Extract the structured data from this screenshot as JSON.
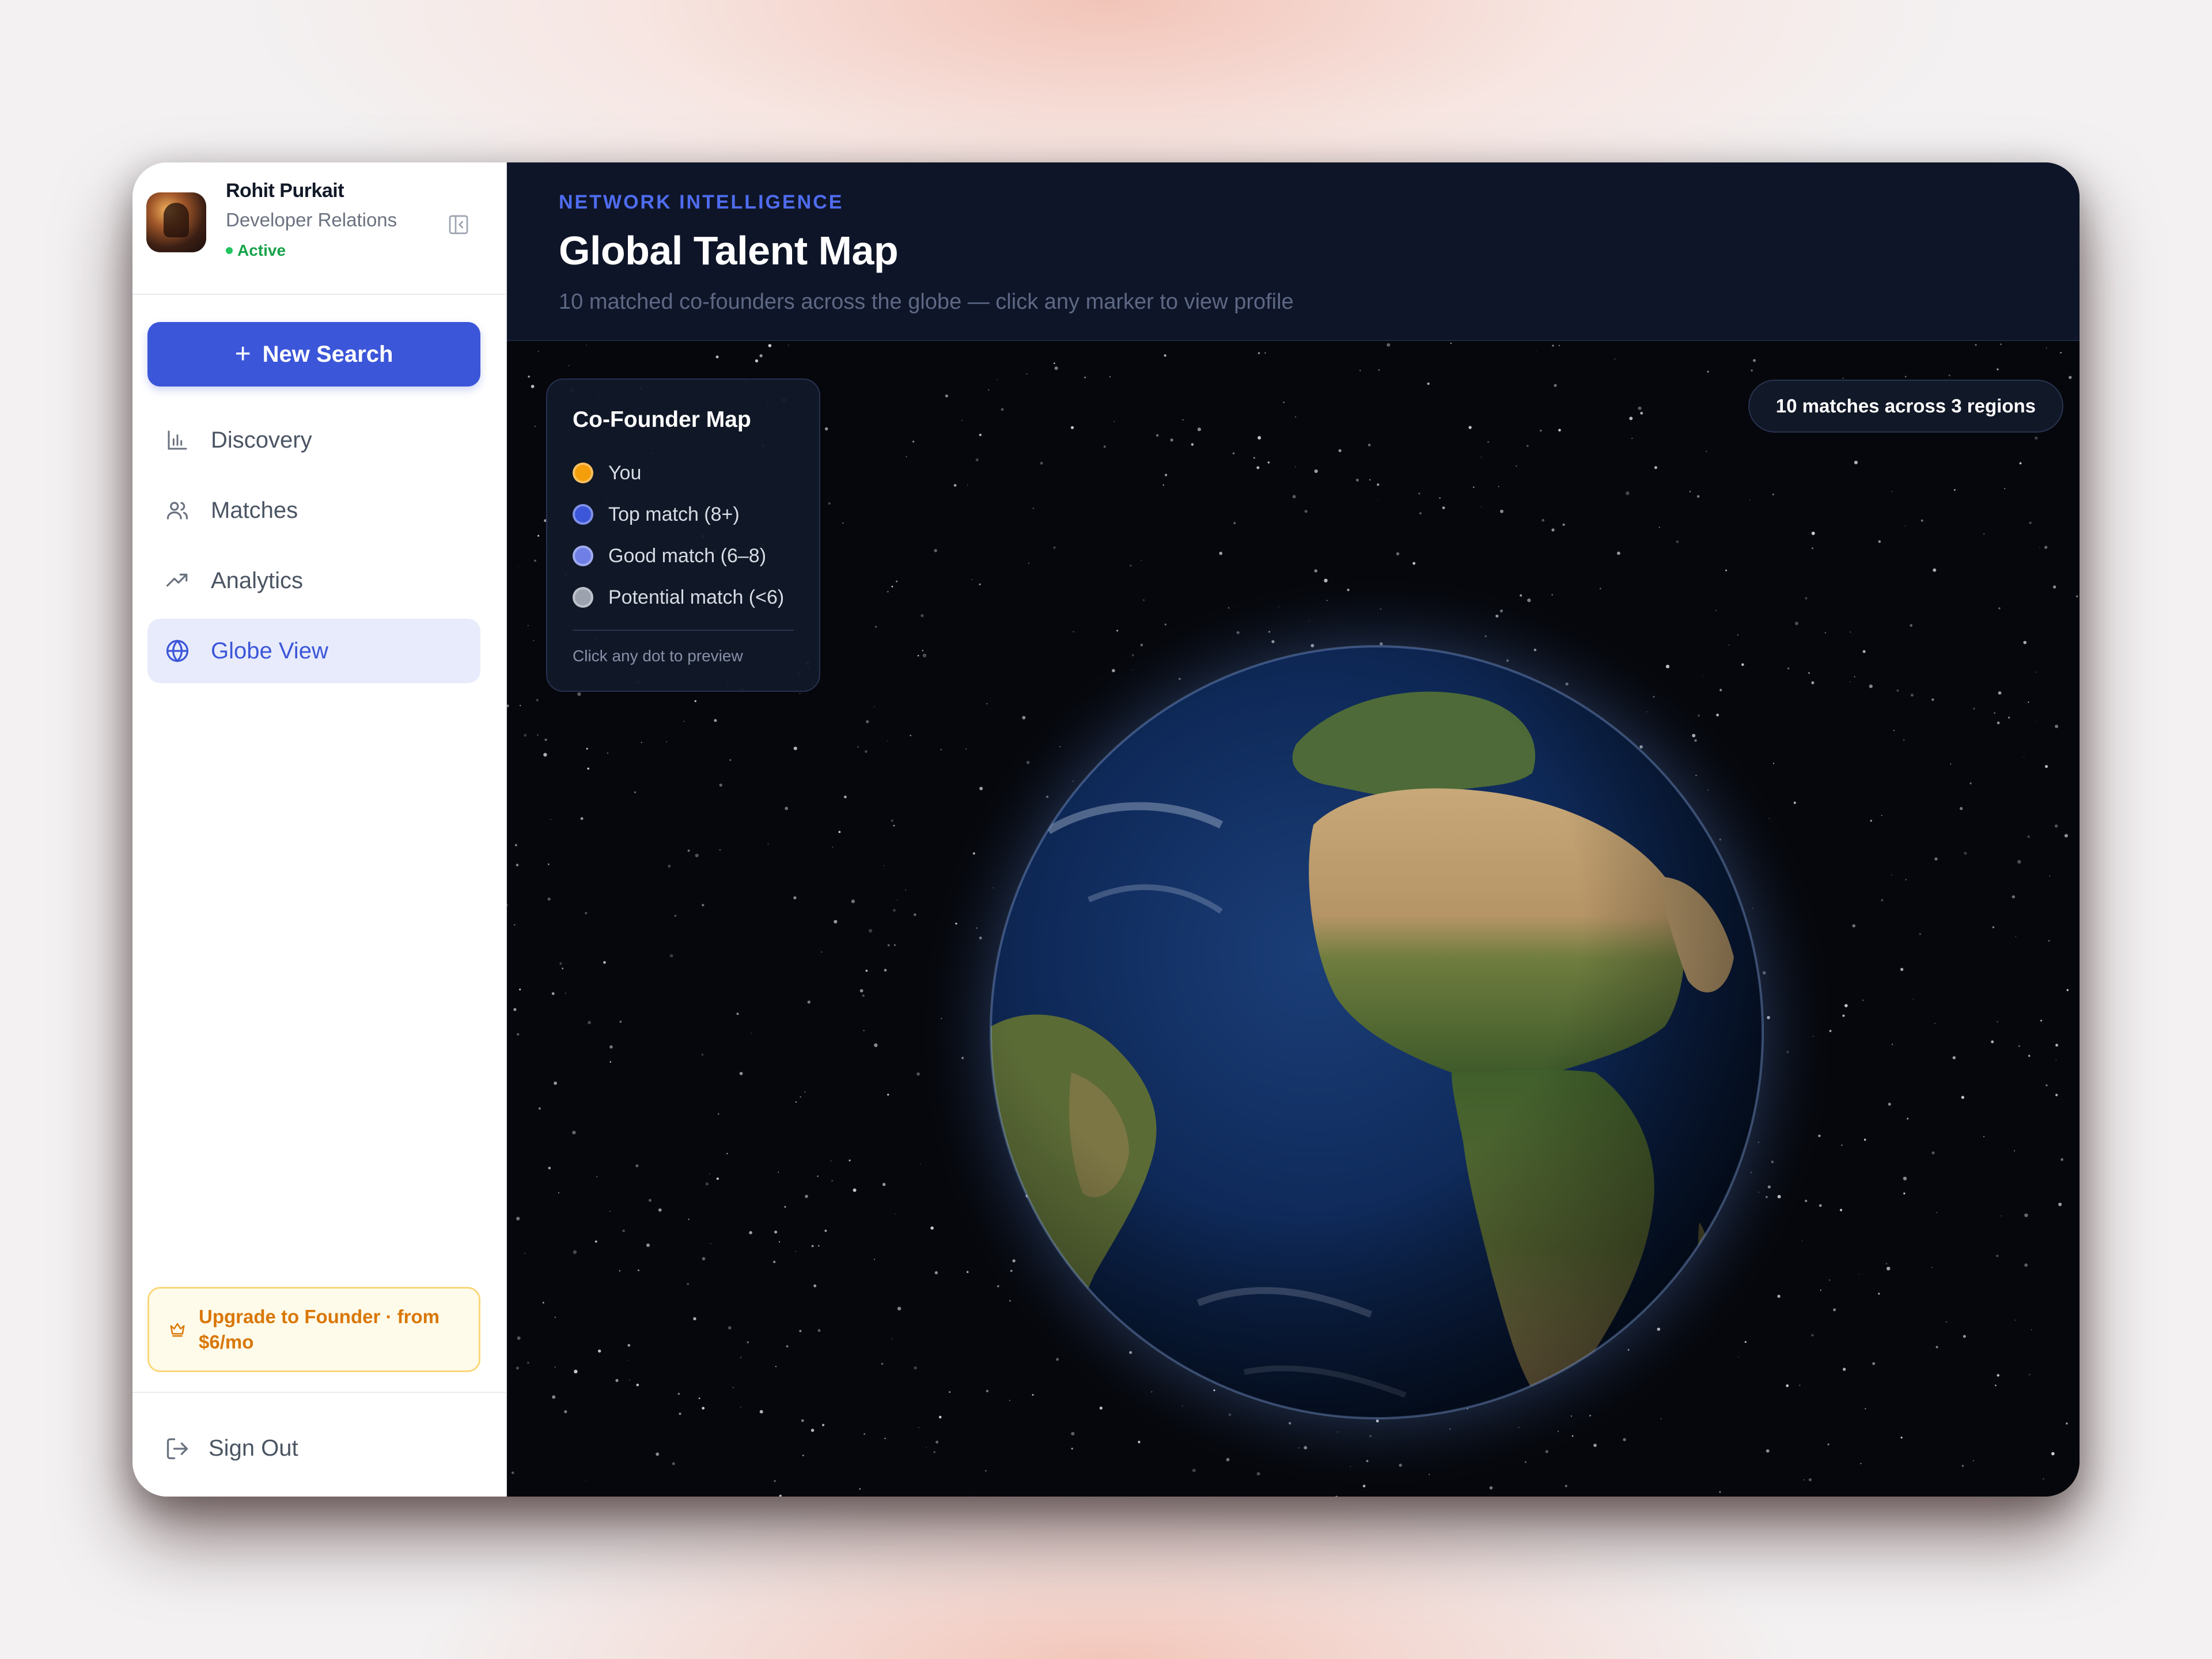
{
  "profile": {
    "name": "Rohit Purkait",
    "role": "Developer Relations",
    "status": "Active"
  },
  "sidebar": {
    "new_search_label": "New Search",
    "items": [
      {
        "label": "Discovery",
        "icon": "bar-chart-icon",
        "active": false
      },
      {
        "label": "Matches",
        "icon": "users-icon",
        "active": false
      },
      {
        "label": "Analytics",
        "icon": "trending-up-icon",
        "active": false
      },
      {
        "label": "Globe View",
        "icon": "globe-icon",
        "active": true
      }
    ],
    "upgrade_label": "Upgrade to Founder · from $6/mo",
    "sign_out_label": "Sign Out"
  },
  "header": {
    "eyebrow": "NETWORK INTELLIGENCE",
    "title": "Global Talent Map",
    "subtitle": "10 matched co-founders across the globe — click any marker to view profile"
  },
  "legend": {
    "title": "Co-Founder Map",
    "items": [
      {
        "label": "You",
        "color": "#f59e0b"
      },
      {
        "label": "Top match (8+)",
        "color": "#3b56d9"
      },
      {
        "label": "Good match (6–8)",
        "color": "#6f7fe6"
      },
      {
        "label": "Potential match (<6)",
        "color": "#9ca3af"
      }
    ],
    "hint": "Click any dot to preview"
  },
  "badge": "10 matches across 3 regions",
  "colors": {
    "accent": "#3b56d9",
    "active_bg": "#e8ebfb",
    "status_green": "#16a34a",
    "upgrade_amber": "#d97706",
    "header_bg": "#0e1528"
  }
}
